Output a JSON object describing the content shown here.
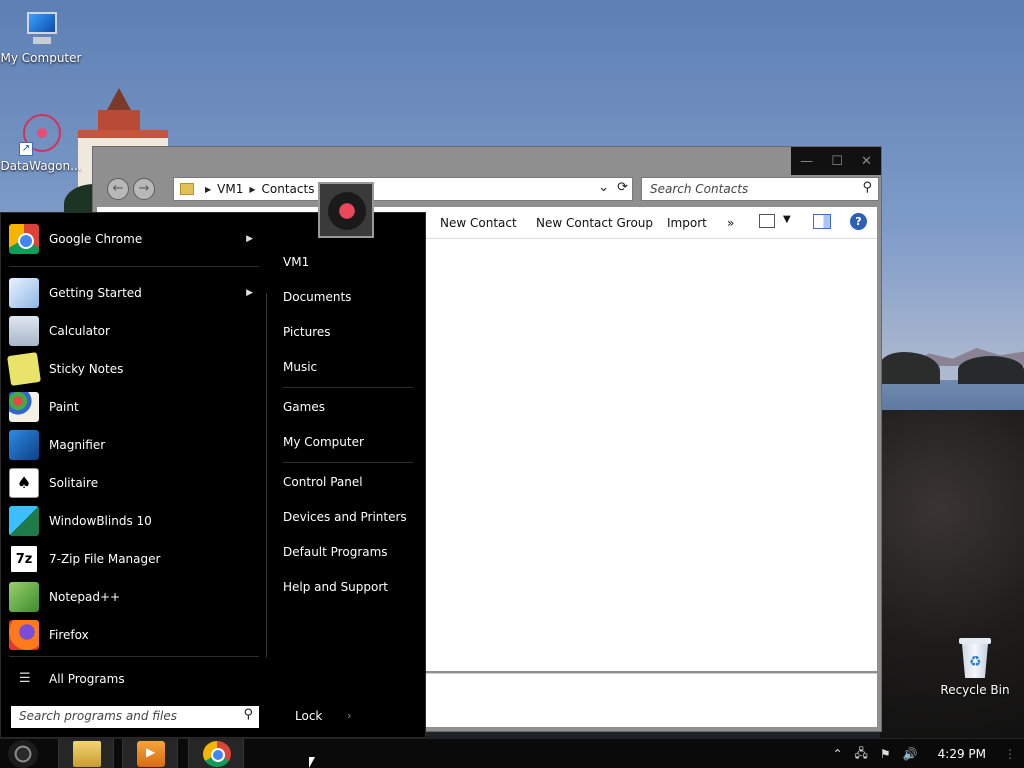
{
  "desktop": {
    "icons": [
      {
        "label": "My Computer",
        "icon": "computer-icon"
      },
      {
        "label": "DataWagon...",
        "icon": "datawagon-shortcut-icon"
      },
      {
        "label": "Recycle Bin",
        "icon": "recycle-bin-icon"
      }
    ]
  },
  "window": {
    "address": {
      "crumbs": [
        "VM1",
        "Contacts"
      ]
    },
    "search_placeholder": "Search Contacts",
    "toolbar": {
      "new_contact": "New Contact",
      "new_contact_group": "New Contact Group",
      "import": "Import",
      "more": "»"
    }
  },
  "start_menu": {
    "programs": [
      {
        "label": "Google Chrome",
        "icon": "chrome-icon",
        "has_submenu": true
      },
      {
        "label": "Getting Started",
        "icon": "getting-started-icon",
        "has_submenu": true
      },
      {
        "label": "Calculator",
        "icon": "calculator-icon"
      },
      {
        "label": "Sticky Notes",
        "icon": "sticky-notes-icon"
      },
      {
        "label": "Paint",
        "icon": "paint-icon"
      },
      {
        "label": "Magnifier",
        "icon": "magnifier-icon"
      },
      {
        "label": "Solitaire",
        "icon": "solitaire-icon"
      },
      {
        "label": "WindowBlinds 10",
        "icon": "windowblinds-icon"
      },
      {
        "label": "7-Zip File Manager",
        "icon": "7zip-icon"
      },
      {
        "label": "Notepad++",
        "icon": "notepadpp-icon"
      },
      {
        "label": "Firefox",
        "icon": "firefox-icon"
      }
    ],
    "all_programs": "All Programs",
    "search_placeholder": "Search programs and files",
    "places": [
      "VM1",
      "Documents",
      "Pictures",
      "Music",
      "Games",
      "My Computer",
      "Control Panel",
      "Devices and Printers",
      "Default Programs",
      "Help and Support"
    ],
    "lock": "Lock"
  },
  "taskbar": {
    "pinned": [
      "file-explorer-icon",
      "media-player-icon",
      "chrome-icon"
    ],
    "tray": {
      "time": "4:29 PM"
    }
  }
}
